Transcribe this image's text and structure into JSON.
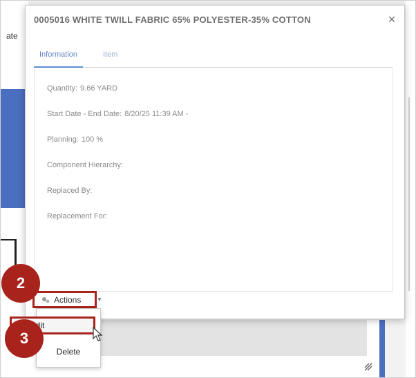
{
  "background": {
    "partial_label": "ate"
  },
  "dialog": {
    "title": "0005016 WHITE TWILL FABRIC 65% POLYESTER-35% COTTON",
    "close_symbol": "×",
    "tabs": [
      {
        "label": "Information",
        "active": true
      },
      {
        "label": "Item",
        "active": false
      }
    ],
    "fields": [
      {
        "label": "Quantity:",
        "value": "9.66 YARD"
      },
      {
        "label": "Start Date - End Date:",
        "value": "8/20/25 11:39 AM -"
      },
      {
        "label": "Planning:",
        "value": "100 %"
      },
      {
        "label": "Component Hierarchy:",
        "value": ""
      },
      {
        "label": "Replaced By:",
        "value": ""
      },
      {
        "label": "Replacement For:",
        "value": ""
      }
    ]
  },
  "actions": {
    "label": "Actions",
    "icon": "actions-gear-icon"
  },
  "menu": {
    "items": [
      {
        "label": "Edit"
      },
      {
        "label": "Delete"
      }
    ]
  },
  "badges": {
    "step_2": "2",
    "step_3": "3"
  },
  "colors": {
    "highlight": "#a8231c",
    "tab_active": "#5b8ed6",
    "bg_blue": "#4a6fc0"
  }
}
